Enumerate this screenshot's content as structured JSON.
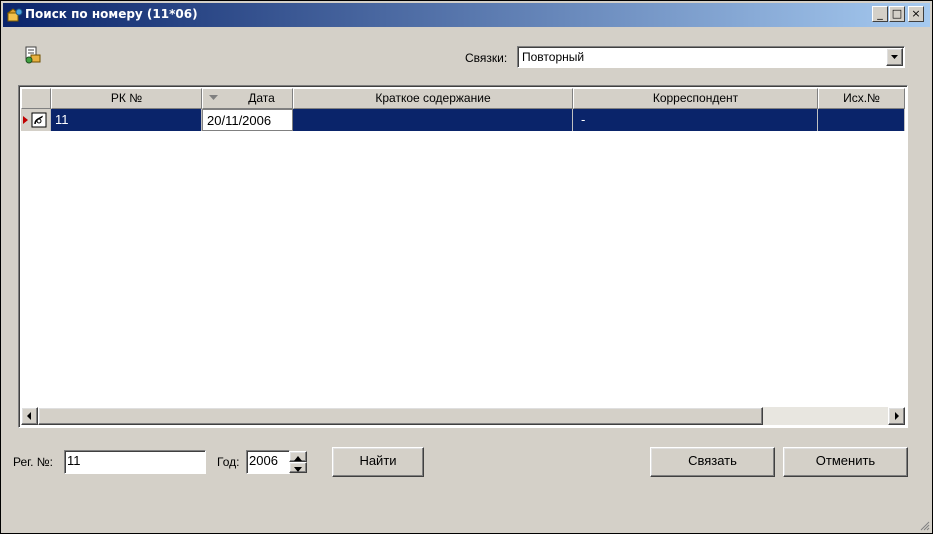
{
  "window": {
    "title": "Поиск по номеру (11*06)",
    "minimize_glyph": "_",
    "maximize_glyph": "□",
    "close_glyph": "×"
  },
  "toolbar": {
    "link_label": "Связки:",
    "link_value": "Повторный"
  },
  "grid": {
    "columns": [
      "РК №",
      "Дата",
      "Краткое содержание",
      "Корреспондент",
      "Исх.№"
    ],
    "rows": [
      {
        "rk": "11",
        "date": "20/11/2006",
        "summary": "",
        "correspondent": "-",
        "out_no": ""
      }
    ]
  },
  "search": {
    "reg_label": "Рег. №:",
    "reg_value": "11",
    "year_label": "Год:",
    "year_value": "2006",
    "find_label": "Найти"
  },
  "actions": {
    "link_label": "Связать",
    "cancel_label": "Отменить"
  },
  "colors": {
    "selection": "#0a246a",
    "face": "#d4d0c8"
  }
}
